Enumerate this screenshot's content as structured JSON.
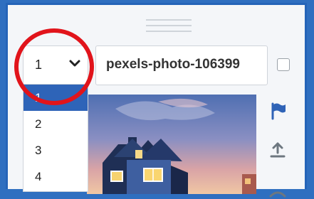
{
  "dialog": {
    "page_select": {
      "value": "1",
      "icon": "chevron-down-icon",
      "options": [
        "1",
        "2",
        "3",
        "4"
      ],
      "selected_index": 0
    },
    "title_field": {
      "value": "pexels-photo-106399"
    },
    "image": {
      "icon": "house-photo"
    },
    "side_toolbar": {
      "icons": [
        "flag-icon",
        "upload-icon",
        "more-icon"
      ]
    }
  },
  "colors": {
    "accent": "#2e64b8",
    "frame": "#2f6fc0",
    "highlight": "#e1141b"
  }
}
